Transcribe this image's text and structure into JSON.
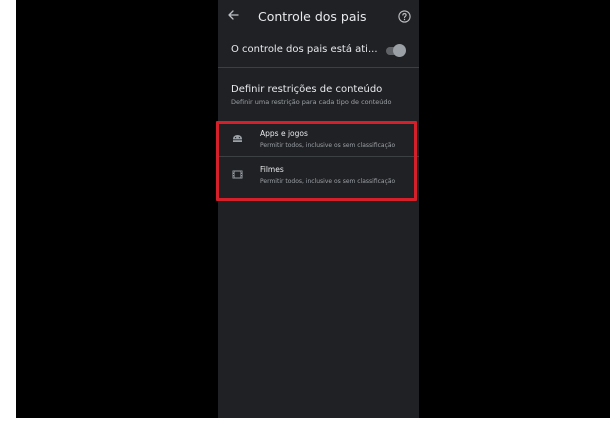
{
  "header": {
    "title": "Controle dos pais",
    "back_icon": "arrow-left-icon",
    "help_icon": "help-circle-icon"
  },
  "toggle": {
    "label": "O controle dos pais está ati...",
    "state": "on"
  },
  "restrictions": {
    "title": "Definir restrições de conteúdo",
    "subtitle": "Definir uma restrição para cada tipo de conteúdo",
    "items": [
      {
        "icon": "android-icon",
        "title": "Apps e jogos",
        "subtitle": "Permitir todos, inclusive os sem classificação"
      },
      {
        "icon": "film-icon",
        "title": "Filmes",
        "subtitle": "Permitir todos, inclusive os sem classificação"
      }
    ]
  },
  "colors": {
    "phone_background": "#202124",
    "highlight": "#d3202a",
    "text_primary": "#e8eaed",
    "text_secondary": "#9aa0a6"
  }
}
